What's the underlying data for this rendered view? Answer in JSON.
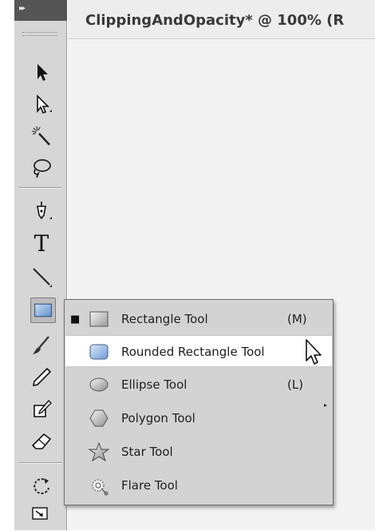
{
  "document": {
    "title": "ClippingAndOpacity* @ 100% (R"
  },
  "toolbar": {
    "collapse_glyph": "▸▸",
    "tools": [
      {
        "name": "selection-tool",
        "icon": "black-arrow-icon"
      },
      {
        "name": "direct-selection-tool",
        "icon": "white-arrow-icon"
      },
      {
        "name": "magic-wand-tool",
        "icon": "magic-wand-icon"
      },
      {
        "name": "lasso-tool",
        "icon": "lasso-icon"
      },
      {
        "name": "pen-tool",
        "icon": "pen-icon"
      },
      {
        "name": "type-tool",
        "icon": "type-icon",
        "glyph": "T"
      },
      {
        "name": "line-segment-tool",
        "icon": "line-icon"
      },
      {
        "name": "rectangle-tool",
        "icon": "rectangle-icon"
      },
      {
        "name": "paintbrush-tool",
        "icon": "brush-icon"
      },
      {
        "name": "pencil-tool",
        "icon": "pencil-icon"
      },
      {
        "name": "blob-brush-tool",
        "icon": "blob-brush-icon"
      },
      {
        "name": "eraser-tool",
        "icon": "eraser-icon"
      },
      {
        "name": "rotate-tool",
        "icon": "rotate-icon"
      },
      {
        "name": "scale-tool",
        "icon": "scale-icon"
      }
    ]
  },
  "flyout": {
    "items": [
      {
        "label": "Rectangle Tool",
        "shortcut": "(M)",
        "selected": true,
        "icon": "rectangle-shape-icon"
      },
      {
        "label": "Rounded Rectangle Tool",
        "shortcut": "",
        "highlighted": true,
        "icon": "rounded-rectangle-shape-icon"
      },
      {
        "label": "Ellipse Tool",
        "shortcut": "(L)",
        "icon": "ellipse-shape-icon"
      },
      {
        "label": "Polygon Tool",
        "shortcut": "",
        "icon": "polygon-shape-icon"
      },
      {
        "label": "Star Tool",
        "shortcut": "",
        "icon": "star-shape-icon"
      },
      {
        "label": "Flare Tool",
        "shortcut": "",
        "icon": "flare-shape-icon"
      }
    ],
    "bullet": "■",
    "submenu_arrow": "▸"
  },
  "colors": {
    "toolbar_bg": "#d6d6d6",
    "toolbar_header": "#555555",
    "menu_bg": "#d3d3d3",
    "menu_highlight": "#ffffff",
    "canvas_bg": "#f2f2f2"
  }
}
